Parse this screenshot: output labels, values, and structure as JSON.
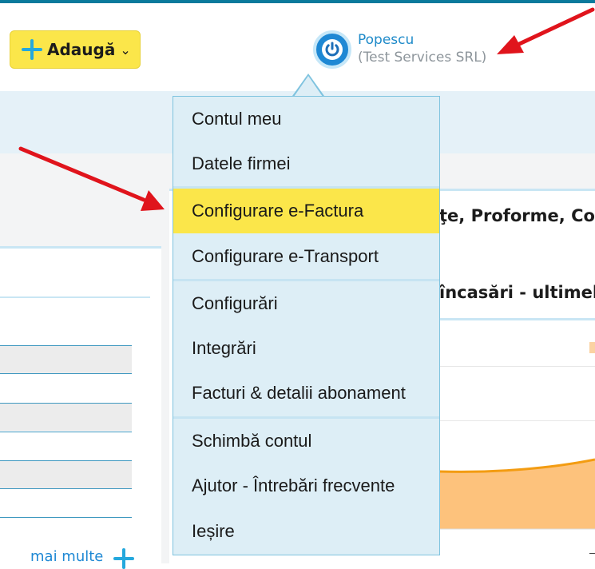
{
  "toolbar": {
    "add_label": "Adaugă"
  },
  "user": {
    "name": "Popescu",
    "company": "(Test Services SRL)"
  },
  "menu": {
    "items": [
      {
        "label": "Contul meu"
      },
      {
        "label": "Datele firmei"
      },
      {
        "label": "Configurare e-Factura",
        "highlighted": true
      },
      {
        "label": "Configurare e-Transport"
      },
      {
        "label": "Configurări"
      },
      {
        "label": "Integrări"
      },
      {
        "label": "Facturi & detalii abonament"
      },
      {
        "label": "Schimbă contul"
      },
      {
        "label": "Ajutor - Întrebări frecvente"
      },
      {
        "label": "Ieșire"
      }
    ]
  },
  "background": {
    "panel_title": "ţe, Proforme, Come",
    "panel_subtitle": "încasări - ultimele",
    "more_link": "mai multe"
  },
  "colors": {
    "accent_yellow": "#fbe64a",
    "accent_blue": "#1e88d4",
    "annotation_red": "#e0141c",
    "chart_orange": "#f7a623"
  },
  "icons": [
    "plus-icon",
    "chevron-down-icon",
    "power-icon",
    "plus-icon"
  ]
}
